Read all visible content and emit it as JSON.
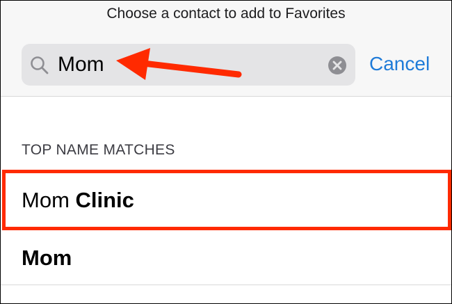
{
  "sheet": {
    "title": "Choose a contact to add to Favorites"
  },
  "search": {
    "value": "Mom",
    "cancel_label": "Cancel",
    "icon": "search-icon",
    "clear_icon": "clear-icon"
  },
  "results": {
    "section_header": "TOP NAME MATCHES",
    "items": [
      {
        "name_regular": "Mom ",
        "name_bold": "Clinic"
      },
      {
        "name_regular": "",
        "name_bold": "Mom"
      }
    ]
  },
  "colors": {
    "accent": "#1f7bd8",
    "annotation": "#ff2a00",
    "search_bg": "#e4e4e6",
    "header_bg": "#f7f7f7"
  }
}
